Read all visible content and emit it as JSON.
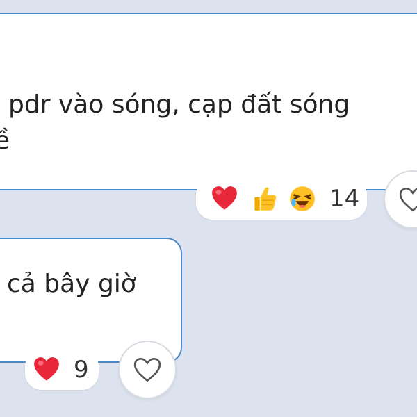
{
  "messages": [
    {
      "lines": [
        "pdr vào sóng, cạp đất sóng",
        "ề"
      ],
      "reactions": {
        "icons": [
          "heart-emoji-icon",
          "thumbs-up-emoji-icon",
          "laughing-emoji-icon"
        ],
        "count": "14"
      }
    },
    {
      "lines": [
        "cả bây giờ"
      ],
      "reactions": {
        "icons": [
          "heart-emoji-icon"
        ],
        "count": "9"
      }
    }
  ],
  "colors": {
    "background": "#dde3ee",
    "bubble": "#ffffff",
    "bubble_border": "#4b89c8",
    "text": "#222222"
  }
}
